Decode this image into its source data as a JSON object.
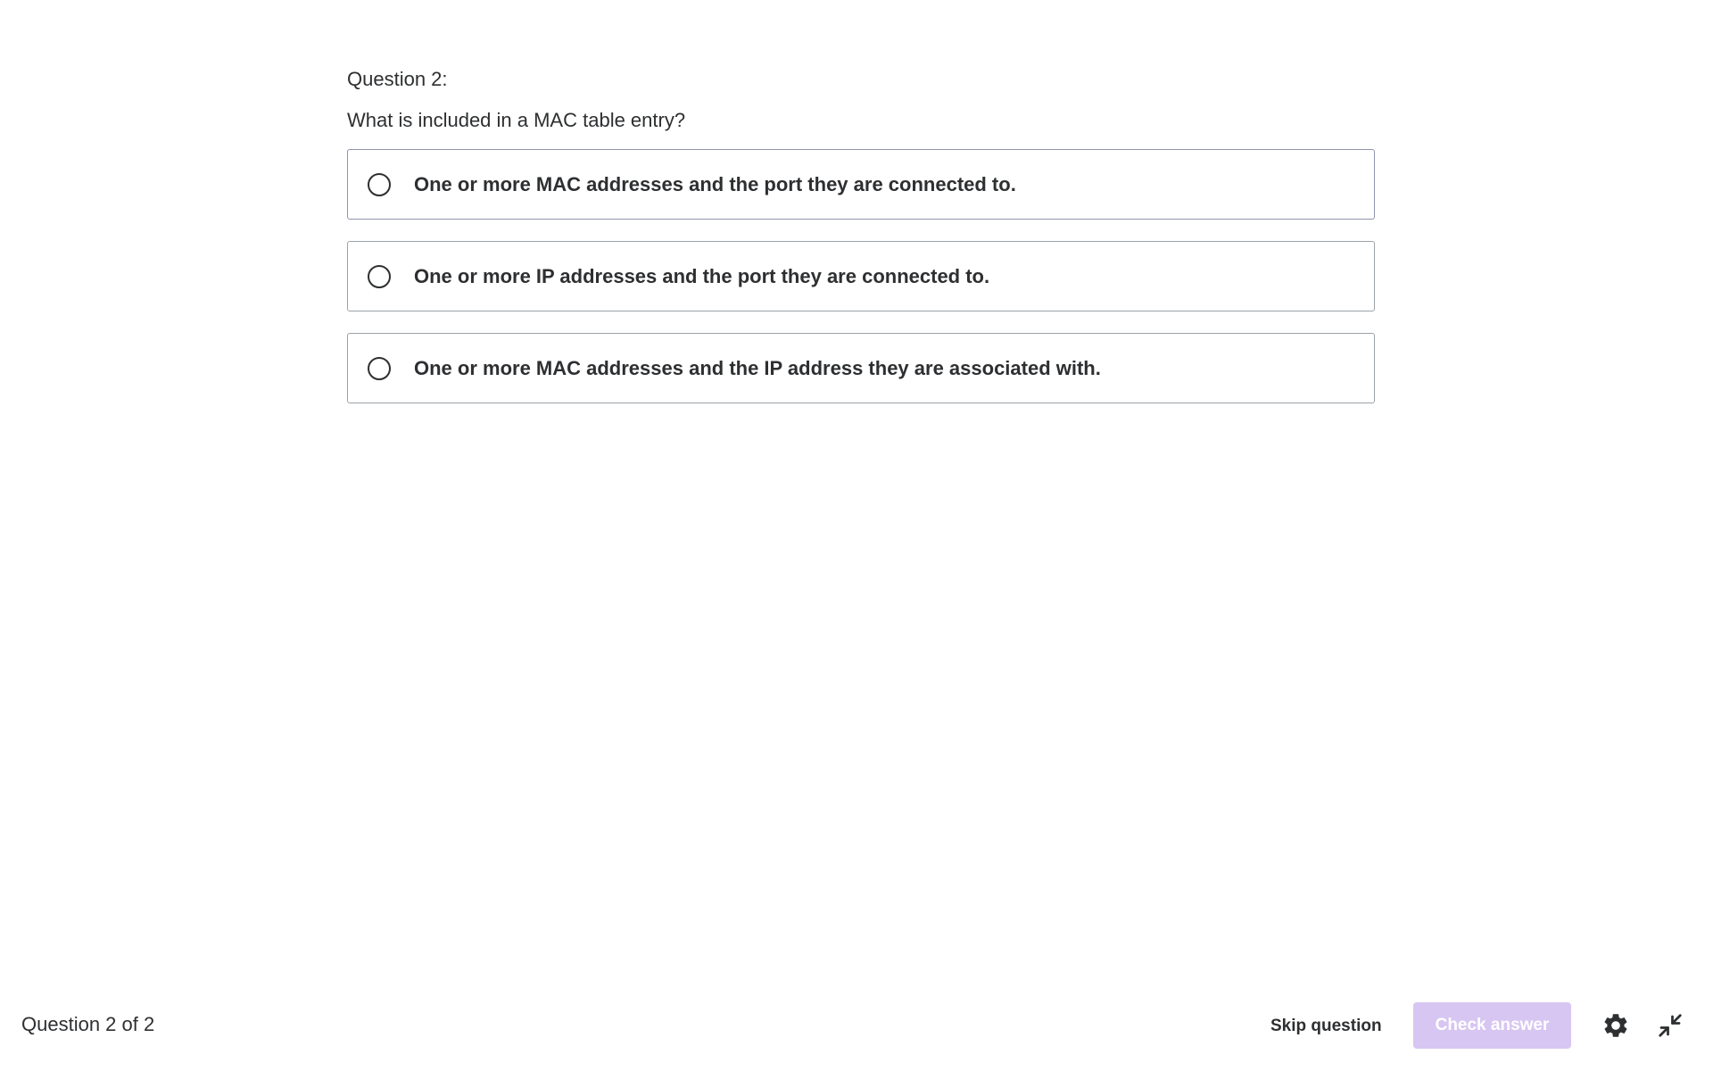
{
  "question": {
    "number_label": "Question 2:",
    "text": "What is included in a MAC table entry?",
    "answers": [
      {
        "label": "One or more MAC addresses and the port they are connected to."
      },
      {
        "label": "One or more IP addresses and the port they are connected to."
      },
      {
        "label": "One or more MAC addresses and the IP address they are associated with."
      }
    ]
  },
  "footer": {
    "progress": "Question 2 of 2",
    "skip_label": "Skip question",
    "check_label": "Check answer",
    "settings_icon": "gear-icon",
    "collapse_icon": "collapse-icon"
  },
  "colors": {
    "text": "#2d2f31",
    "check_button_disabled": "#d7c6f2",
    "answer_border": "#9194ac"
  }
}
